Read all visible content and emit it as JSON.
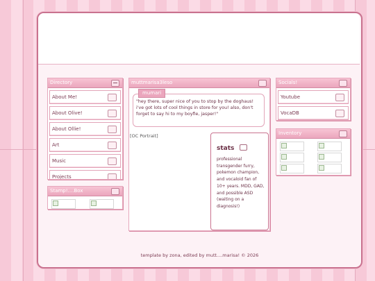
{
  "directory": {
    "title": "Directory",
    "items": [
      "About Me!",
      "About Olive!",
      "About Ollie!",
      "Art",
      "Music",
      "Projects"
    ]
  },
  "stamp": {
    "title": "Stamp!....Box"
  },
  "main": {
    "title": "muttmarisa3leso",
    "speaker": "mumari",
    "speech": "\"hey there, super nice of you to stop by the doghaus! i've got lots of cool things in store for you! also, don't forget to say hi to my boyfie, jasper!\"",
    "portrait_alt": "[OC Portrait]",
    "stats_title": "stats",
    "stats_text": "professional transgender furry, pokemon champion, and vocaloid fan of 10+ years. MDD, GAD, and possible ASD (waiting on a diagnosis!)"
  },
  "socials": {
    "title": "Socials!",
    "items": [
      "Youtube",
      "VocaDB"
    ]
  },
  "inventory": {
    "title": "Inventory"
  },
  "footer": "template by zona, edited by mutt....marisa! © 2026",
  "colors": {
    "accent": "#eba6bd",
    "border": "#c9728f",
    "text": "#7b3a52"
  }
}
